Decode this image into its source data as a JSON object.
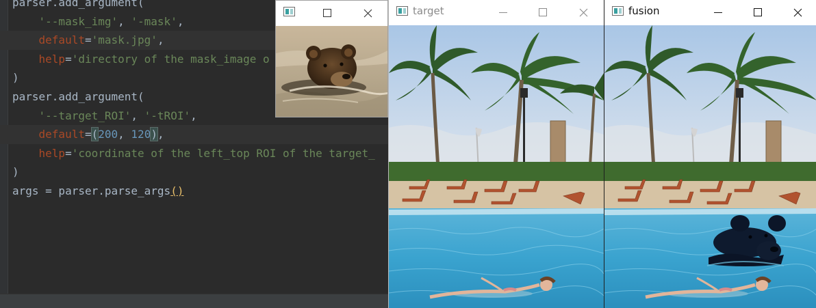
{
  "editor": {
    "lines": {
      "l1": {
        "text": "parser.add_argument("
      },
      "l2": {
        "s1": "'--mask_img'",
        "comma": ", ",
        "s2": "'-mask'",
        "end": ","
      },
      "l3": {
        "kw": "default",
        "eq": "=",
        "val": "'mask.jpg'",
        "end": ","
      },
      "l4": {
        "kw": "help",
        "eq": "=",
        "val": "'directory of the mask_image o"
      },
      "l5": {
        "text": ")"
      },
      "l6": {
        "text": "parser.add_argument("
      },
      "l7": {
        "s1": "'--target_ROI'",
        "comma": ", ",
        "s2": "'-tROI'",
        "end": ","
      },
      "l8": {
        "kw": "default",
        "eq": "=",
        "open": "(",
        "n1": "200",
        "comma": ", ",
        "n2": "120",
        "close": ")",
        "end": ","
      },
      "l9": {
        "kw": "help",
        "eq": "=",
        "val": "'coordinate of the left_top ROI of the target_"
      },
      "l10": {
        "text": ")"
      },
      "l11": {
        "text": "args = parser.parse_args",
        "paren": "()"
      }
    }
  },
  "windows": {
    "mask": {
      "title": "",
      "icon": "app-window-icon",
      "minimize_icon": "none",
      "maximize_icon": "maximize-icon",
      "close_icon": "close-icon",
      "image": "brown bear swimming in water"
    },
    "target": {
      "title": "target",
      "icon": "app-window-icon",
      "minimize_icon": "minimize-icon",
      "maximize_icon": "maximize-icon",
      "close_icon": "close-icon",
      "image": "resort pool with palm trees and a woman floating"
    },
    "fusion": {
      "title": "fusion",
      "icon": "app-window-icon",
      "minimize_icon": "minimize-icon",
      "maximize_icon": "maximize-icon",
      "close_icon": "close-icon",
      "image": "resort pool with a bear blended into the water"
    }
  },
  "colors": {
    "editor_bg": "#2b2b2b",
    "string": "#6a8759",
    "keyword_arg": "#aa4926",
    "number": "#6897bb",
    "default_text": "#a9b7c6"
  }
}
